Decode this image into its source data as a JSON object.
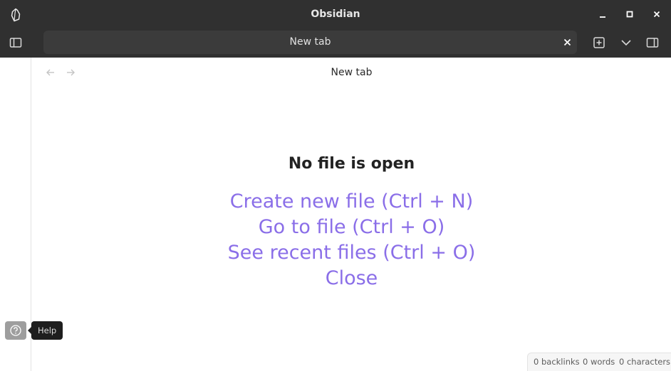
{
  "window": {
    "title": "Obsidian"
  },
  "tabs": [
    {
      "label": "New tab",
      "active": true
    }
  ],
  "view": {
    "title": "New tab"
  },
  "empty_state": {
    "title": "No file is open",
    "actions": [
      "Create new file (Ctrl + N)",
      "Go to file (Ctrl + O)",
      "See recent files (Ctrl + O)",
      "Close"
    ]
  },
  "ribbon": {
    "help_tooltip": "Help"
  },
  "status_bar": {
    "backlinks": "0 backlinks",
    "words": "0 words",
    "characters": "0 characters"
  },
  "colors": {
    "titlebar_bg": "#303030",
    "tab_bg": "#3b3b3b",
    "accent": "#8a6ee8",
    "tooltip_bg": "#1e1e1e"
  },
  "icons": {
    "logo": "obsidian-logo-icon",
    "minimize": "minimize-icon",
    "maximize": "maximize-icon",
    "close": "close-icon",
    "left_sidebar": "sidebar-left-icon",
    "tab_close": "close-icon",
    "new_tab": "plus-square-icon",
    "tab_list": "chevron-down-icon",
    "right_sidebar": "sidebar-right-icon",
    "back": "arrow-left-icon",
    "forward": "arrow-right-icon",
    "help": "help-circle-icon"
  }
}
